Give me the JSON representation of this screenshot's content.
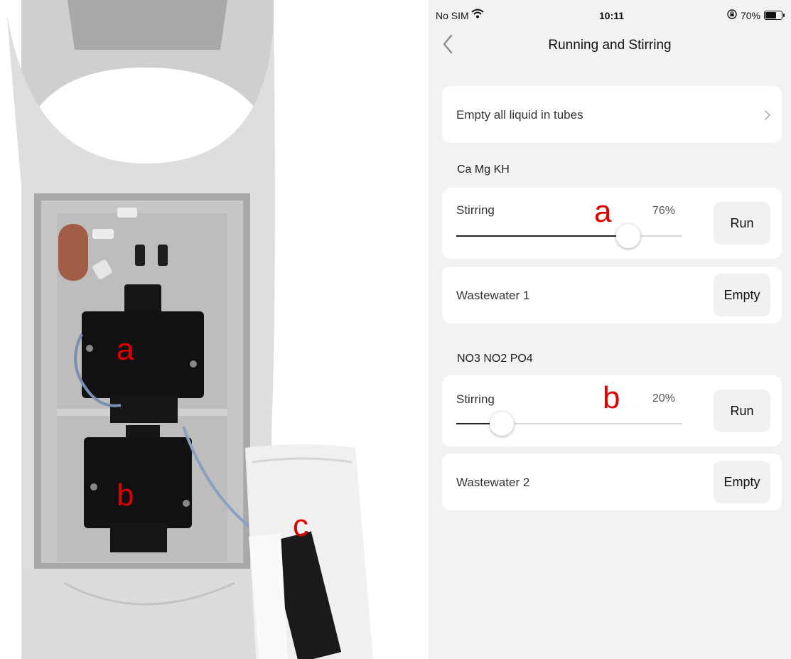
{
  "photo": {
    "labels": [
      "a",
      "b",
      "c"
    ],
    "colors": {
      "housing": "#d9d9d9",
      "cavity": "#bfbfbf",
      "module": "#111111",
      "annotation": "#e00000"
    }
  },
  "status_bar": {
    "carrier": "No SIM",
    "time": "10:11",
    "battery_text": "70%",
    "battery_level": 0.7,
    "icons": [
      "wifi-icon",
      "orientation-lock-icon",
      "battery-icon"
    ]
  },
  "navbar": {
    "title": "Running and Stirring",
    "back_icon": "chevron-left-icon"
  },
  "empty_all": {
    "label": "Empty all liquid in tubes",
    "icon": "chevron-right-icon"
  },
  "groups": [
    {
      "title": "Ca Mg KH",
      "stirring": {
        "label": "Stirring",
        "value_text": "76%",
        "value": 76,
        "button": "Run",
        "annotation": "a"
      },
      "wastewater": {
        "label": "Wastewater 1",
        "button": "Empty"
      }
    },
    {
      "title": "NO3 NO2 PO4",
      "stirring": {
        "label": "Stirring",
        "value_text": "20%",
        "value": 20,
        "button": "Run",
        "annotation": "b"
      },
      "wastewater": {
        "label": "Wastewater 2",
        "button": "Empty"
      }
    }
  ],
  "theme": {
    "background": "#f2f2f2",
    "card": "#ffffff",
    "button": "#f1f1f1",
    "slider_fill": "#222222",
    "slider_track": "#d8d8d8"
  }
}
